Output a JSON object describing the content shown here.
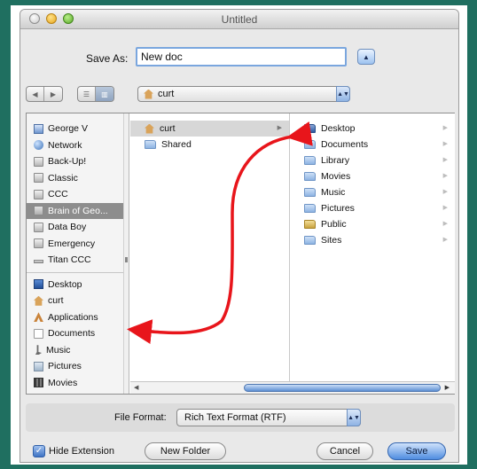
{
  "window": {
    "title": "Untitled"
  },
  "save_as": {
    "label": "Save As:",
    "value": "New doc"
  },
  "path_popup": {
    "value": "curt"
  },
  "sidebar": {
    "devices": [
      {
        "label": "George V",
        "icon": "computer-icon"
      },
      {
        "label": "Network",
        "icon": "network-icon"
      },
      {
        "label": "Back-Up!",
        "icon": "disk-icon"
      },
      {
        "label": "Classic",
        "icon": "disk-icon"
      },
      {
        "label": "CCC",
        "icon": "disk-icon"
      },
      {
        "label": "Brain of Geo...",
        "icon": "disk-icon",
        "selected": true
      },
      {
        "label": "Data Boy",
        "icon": "disk-icon"
      },
      {
        "label": "Emergency",
        "icon": "disk-icon"
      },
      {
        "label": "Titan CCC",
        "icon": "thin-disk-icon"
      }
    ],
    "places": [
      {
        "label": "Desktop",
        "icon": "desktop-icon"
      },
      {
        "label": "curt",
        "icon": "home-icon"
      },
      {
        "label": "Applications",
        "icon": "applications-icon"
      },
      {
        "label": "Documents",
        "icon": "documents-icon"
      },
      {
        "label": "Music",
        "icon": "music-icon"
      },
      {
        "label": "Pictures",
        "icon": "pictures-icon"
      },
      {
        "label": "Movies",
        "icon": "movies-icon"
      }
    ]
  },
  "column1": [
    {
      "label": "curt",
      "icon": "home-icon",
      "selected": true
    },
    {
      "label": "Shared",
      "icon": "folder-icon"
    }
  ],
  "column2": [
    {
      "label": "Desktop",
      "icon": "folder-dark-icon"
    },
    {
      "label": "Documents",
      "icon": "folder-icon"
    },
    {
      "label": "Library",
      "icon": "folder-icon"
    },
    {
      "label": "Movies",
      "icon": "folder-icon"
    },
    {
      "label": "Music",
      "icon": "folder-icon"
    },
    {
      "label": "Pictures",
      "icon": "folder-icon"
    },
    {
      "label": "Public",
      "icon": "folder-public-icon"
    },
    {
      "label": "Sites",
      "icon": "folder-icon"
    }
  ],
  "file_format": {
    "label": "File Format:",
    "value": "Rich Text Format (RTF)"
  },
  "hide_extension": {
    "label": "Hide Extension",
    "checked": true
  },
  "buttons": {
    "new_folder": "New Folder",
    "cancel": "Cancel",
    "save": "Save"
  },
  "annotation": {
    "arrow_color": "#e8151b"
  }
}
